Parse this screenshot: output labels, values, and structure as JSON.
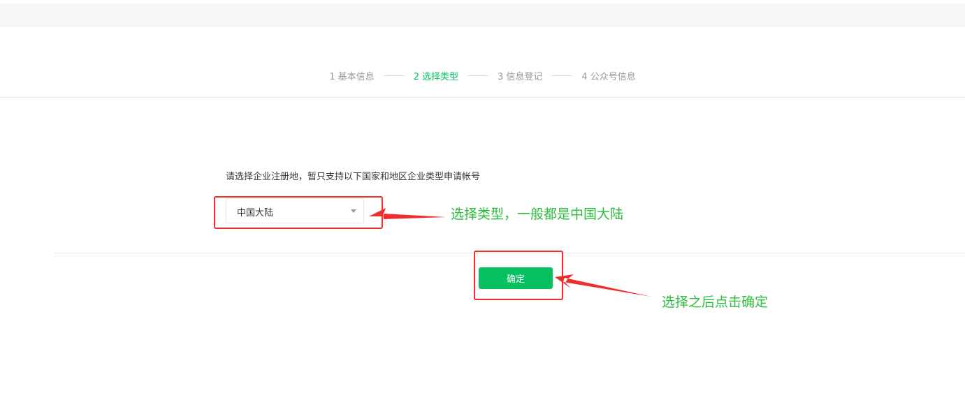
{
  "steps": [
    {
      "label": "1 基本信息",
      "active": false
    },
    {
      "label": "2 选择类型",
      "active": true
    },
    {
      "label": "3 信息登记",
      "active": false
    },
    {
      "label": "4 公众号信息",
      "active": false
    }
  ],
  "form": {
    "instruction": "请选择企业注册地，暂只支持以下国家和地区企业类型申请帐号",
    "region_select": {
      "value": "中国大陆"
    },
    "confirm_label": "确定"
  },
  "annotations": {
    "select_note": "选择类型，一般都是中国大陆",
    "confirm_note": "选择之后点击确定"
  },
  "colors": {
    "brand_green": "#07c160",
    "annotation_red": "#f02d2d",
    "annotation_green": "#2dbd3c"
  }
}
